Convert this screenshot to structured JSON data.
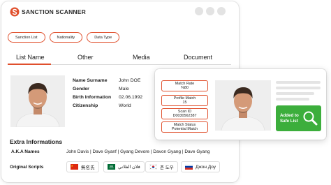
{
  "app": {
    "name": "SANCTION SCANNER"
  },
  "filters": [
    "Sanction List",
    "Nationality",
    "Data Type"
  ],
  "tabs": [
    "List Name",
    "Other",
    "Media",
    "Document"
  ],
  "profile": {
    "rows": [
      {
        "label": "Name Surname",
        "value": "John DOE"
      },
      {
        "label": "Gender",
        "value": "Male"
      },
      {
        "label": "Birth Information",
        "value": "02.06.1992"
      },
      {
        "label": "Citizenship",
        "value": "World"
      }
    ]
  },
  "extra": {
    "title": "Extra Informations",
    "aka_label": "A.K.A Names",
    "aka_values": "John Davis  |  Dave Gyanf  |  Gyang Devore  |  Davon Gyang  |  Dave Gyang",
    "scripts_label": "Original Scripts",
    "scripts": [
      {
        "flag": "china-flag-icon",
        "text": "無名氏"
      },
      {
        "flag": "saudi-flag-icon",
        "text": "فلان الفلاني"
      },
      {
        "flag": "korea-flag-icon",
        "text": "존 도우"
      },
      {
        "flag": "russia-flag-icon",
        "text": "Джон Доу"
      }
    ]
  },
  "match_card": {
    "fields": [
      {
        "label": "Match Rate",
        "value": "%80"
      },
      {
        "label": "Profile Match",
        "value": "15"
      },
      {
        "label": "Scan ID",
        "value": "D0030562387"
      },
      {
        "label": "Match Status",
        "value": "Potential Match"
      }
    ],
    "button_label": "Added to\nSafe List"
  },
  "colors": {
    "accent": "#e0502d",
    "success": "#3cae3c",
    "skeleton": "#e4e4e4"
  }
}
